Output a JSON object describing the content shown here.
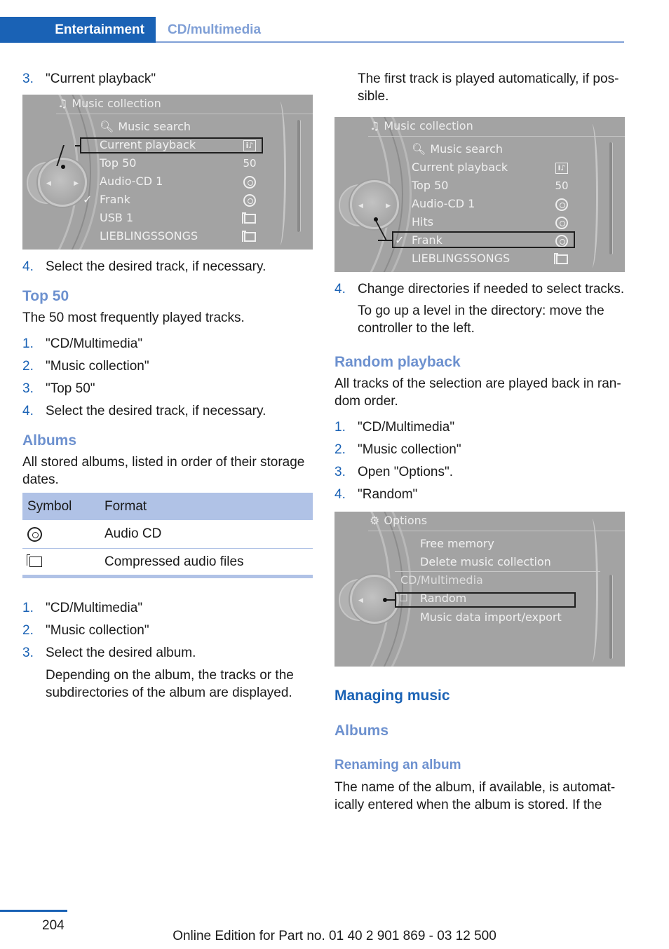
{
  "header": {
    "section": "Entertainment",
    "subsection": "CD/multimedia"
  },
  "left": {
    "step_current_playback": {
      "num": "3.",
      "text": "\"Current playback\""
    },
    "screen1": {
      "title": "Music collection",
      "items": [
        {
          "label": "Music search",
          "icon": "search-icon",
          "value": ""
        },
        {
          "label": "Current playback",
          "icon": "",
          "value": "info-music-icon",
          "selected": true
        },
        {
          "label": "Top 50",
          "value": "50"
        },
        {
          "label": "Audio-CD 1",
          "value": "cd-icon"
        },
        {
          "label": "Frank",
          "checked": true,
          "value": "cd-icon"
        },
        {
          "label": "USB 1",
          "value": "folder-icon"
        },
        {
          "label": "LIEBLINGSSONGS",
          "value": "folder-icon"
        }
      ]
    },
    "step_select_track": {
      "num": "4.",
      "text": "Select the desired track, if necessary."
    },
    "top50": {
      "heading": "Top 50",
      "desc": "The 50 most frequently played tracks.",
      "steps": [
        {
          "num": "1.",
          "text": "\"CD/Multimedia\""
        },
        {
          "num": "2.",
          "text": "\"Music collection\""
        },
        {
          "num": "3.",
          "text": "\"Top 50\""
        },
        {
          "num": "4.",
          "text": "Select the desired track, if necessary."
        }
      ]
    },
    "albums": {
      "heading": "Albums",
      "desc": "All stored albums, listed in order of their storage dates.",
      "table": {
        "headers": [
          "Symbol",
          "Format"
        ],
        "rows": [
          {
            "symbol": "cd-icon",
            "format": "Audio CD"
          },
          {
            "symbol": "folder-icon",
            "format": "Compressed audio files"
          }
        ]
      },
      "steps": [
        {
          "num": "1.",
          "text": "\"CD/Multimedia\""
        },
        {
          "num": "2.",
          "text": "\"Music collection\""
        },
        {
          "num": "3.",
          "text": "Select the desired album."
        }
      ],
      "note": "Depending on the album, the tracks or the subdirectories of the album are displayed."
    }
  },
  "right": {
    "intro": "The first track is played automatically, if pos-sible.",
    "screen2": {
      "title": "Music collection",
      "items": [
        {
          "label": "Music search",
          "icon": "search-icon",
          "value": ""
        },
        {
          "label": "Current playback",
          "value": "info-music-icon"
        },
        {
          "label": "Top 50",
          "value": "50"
        },
        {
          "label": "Audio-CD 1",
          "value": "cd-icon"
        },
        {
          "label": "Hits",
          "value": "cd-icon"
        },
        {
          "label": "Frank",
          "checked": true,
          "value": "cd-icon",
          "selected": true
        },
        {
          "label": "LIEBLINGSSONGS",
          "value": "folder-icon"
        }
      ]
    },
    "step_change_dir": {
      "num": "4.",
      "text": "Change directories if needed to select tracks."
    },
    "step_change_dir_note": "To go up a level in the directory: move the controller to the left.",
    "random": {
      "heading": "Random playback",
      "desc": "All tracks of the selection are played back in ran-dom order.",
      "steps": [
        {
          "num": "1.",
          "text": "\"CD/Multimedia\""
        },
        {
          "num": "2.",
          "text": "\"Music collection\""
        },
        {
          "num": "3.",
          "text": "Open \"Options\"."
        },
        {
          "num": "4.",
          "text": "\"Random\""
        }
      ]
    },
    "screen3": {
      "title": "Options",
      "items": [
        {
          "label": "Free memory"
        },
        {
          "label": "Delete music collection"
        },
        {
          "label": "CD/Multimedia",
          "section_header": true
        },
        {
          "label": "Random",
          "checkbox": true,
          "checked": false,
          "selected": true
        },
        {
          "label": "Music data import/export"
        }
      ]
    },
    "managing": {
      "heading": "Managing music",
      "subheading": "Albums",
      "subsubheading": "Renaming an album",
      "text": "The name of the album, if available, is automat-ically entered when the album is stored. If the"
    }
  },
  "footer": {
    "page": "204",
    "edition": "Online Edition for Part no. 01 40 2 901 869 - 03 12 500"
  }
}
